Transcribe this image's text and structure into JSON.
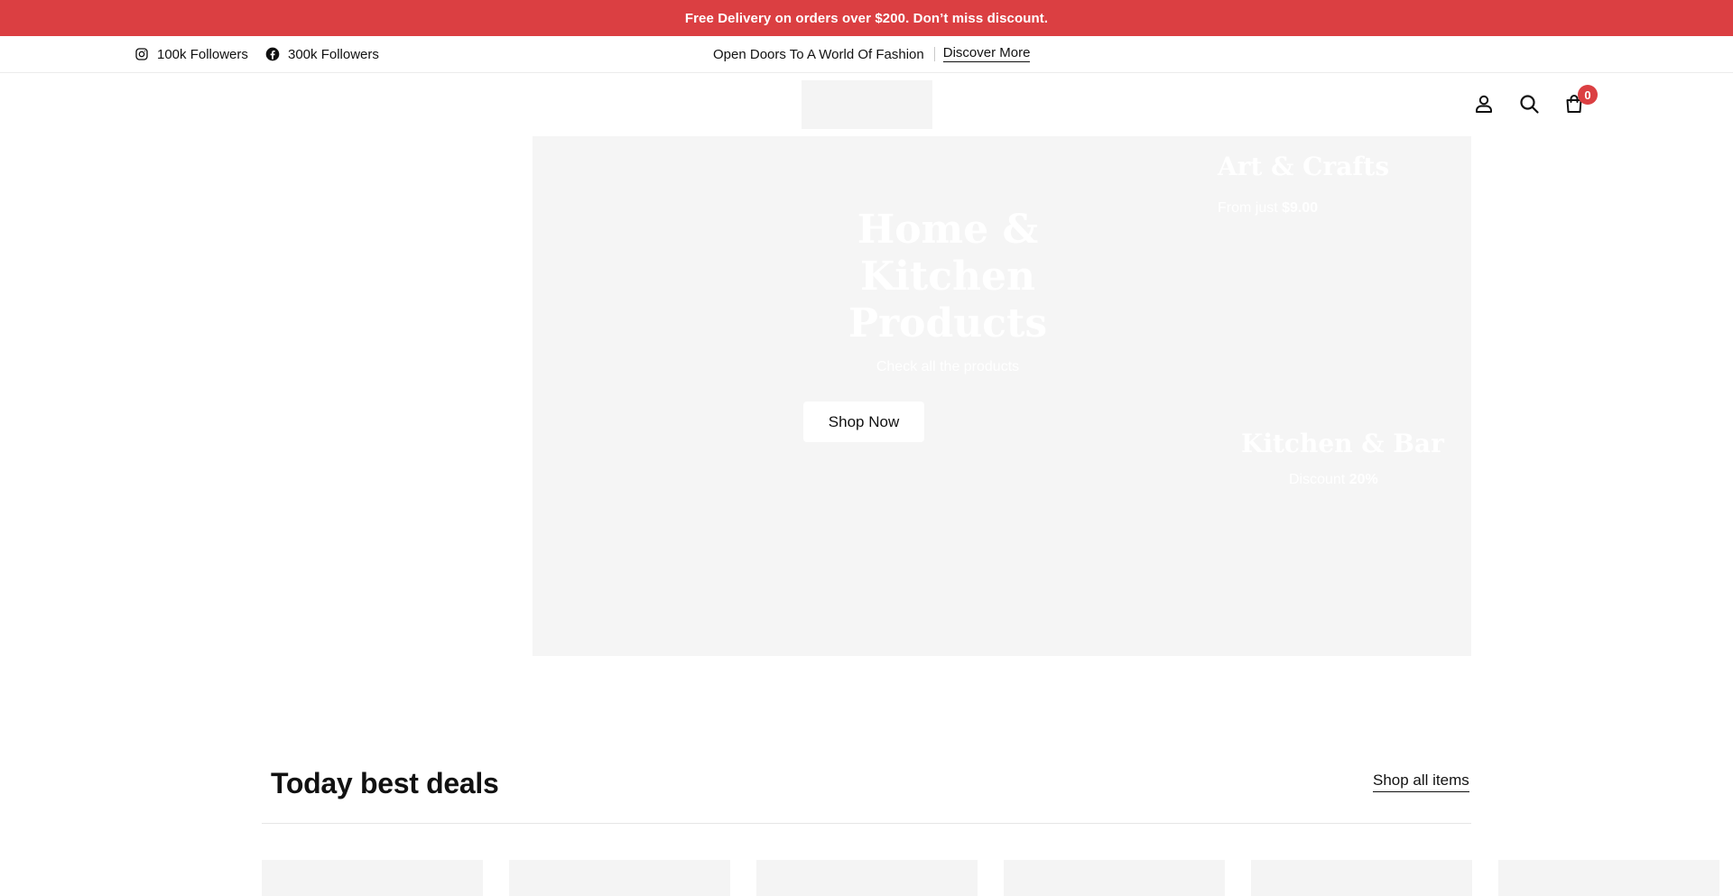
{
  "announcement": {
    "text": "Free Delivery on orders over $200. Don’t miss discount."
  },
  "topbar": {
    "instagram": {
      "icon": "instagram-icon",
      "label": "100k Followers"
    },
    "facebook": {
      "icon": "facebook-icon",
      "label": "300k Followers"
    },
    "promo_text": "Open Doors To A World Of Fashion",
    "promo_link": "Discover More"
  },
  "header": {
    "icons": [
      "user-icon",
      "search-icon",
      "shopping-bag-icon"
    ],
    "cart_count": "0"
  },
  "hero": {
    "title_lines": [
      "Home &",
      "Kitchen",
      "Products"
    ],
    "subtitle": "Check all the products",
    "button": "Shop Now"
  },
  "promo_cards": [
    {
      "title": "Art & Crafts",
      "sub_prefix": "From just",
      "sub_value": "$9.00"
    },
    {
      "title": "Kitchen & Bar",
      "sub_prefix": "Discount",
      "sub_value": "20%"
    }
  ],
  "deals": {
    "title": "Today best deals",
    "link": "Shop all items",
    "card_count": 6
  },
  "colors": {
    "accent": "#db3f42",
    "placeholder": "#f5f5f5",
    "text": "#111111"
  }
}
